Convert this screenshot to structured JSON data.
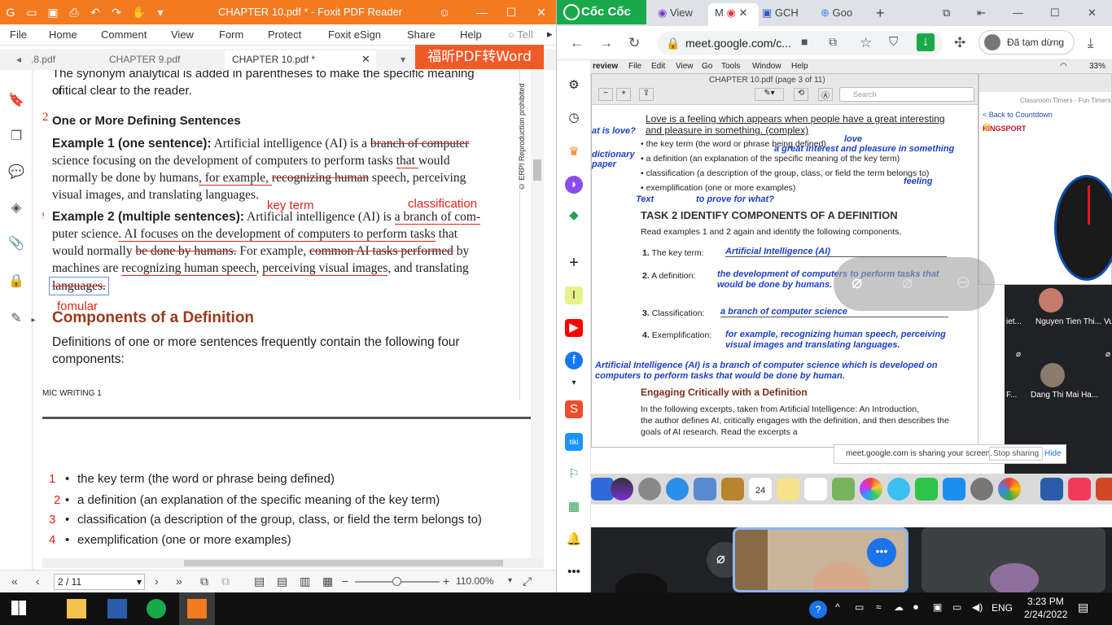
{
  "foxit": {
    "title": "CHAPTER 10.pdf * - Foxit PDF Reader",
    "menu": [
      "File",
      "Home",
      "Comment",
      "View",
      "Form",
      "Protect",
      "Foxit eSign",
      "Share",
      "Help",
      "Tell"
    ],
    "tabs": [
      ".8.pdf",
      "CHAPTER 9.pdf",
      "CHAPTER 10.pdf *"
    ],
    "promo": "福昕PDF转Word",
    "page_indicator": "2 / 11",
    "zoom": "110.00%",
    "watermark": "© ERPI Reproduction prohibited",
    "doc": {
      "line_top": "The synonym analytical is added in parentheses to make the specific meaning of",
      "line_top2": "critical clear to the reader.",
      "heading1": "One or More Defining Sentences",
      "ex1_label": "Example 1 (one sentence):",
      "ex1_text_a": " Artificial intelligence (AI) is a ",
      "ex1_strike": "branch of computer",
      "ex1_line2_a": "science focusing on the development of computers to perform tasks ",
      "ex1_line2_b": "that ",
      "ex1_line2_c": "would",
      "ex1_line3_a": "normally be done by humans",
      "ex1_line3_b": ", for example, ",
      "ex1_line3_c": "recognizing human",
      "ex1_line3_d": " speech, perceiving",
      "ex1_line4": "visual images, and translating languages.",
      "ex2_label": "Example 2 (multiple sentences):",
      "ex2_text_a": " Artificial intelligence (AI) is ",
      "ex2_text_b": "a branch of com-",
      "ex2_line2_a": "puter science",
      "ex2_line2_b": ". AI focuses on the development of computers to ",
      "ex2_line2_c": "perform tasks",
      "ex2_line2_d": " that",
      "ex2_line3_a": "would normally ",
      "ex2_line3_b": "be done by humans.",
      "ex2_line3_c": " For example, ",
      "ex2_line3_d": "common AI tasks performed",
      "ex2_line3_e": " by",
      "ex2_line4_a": "machines are ",
      "ex2_line4_b": "recognizing human speech",
      "ex2_line4_c": ", ",
      "ex2_line4_d": "perceiving visual images",
      "ex2_line4_e": ", and translating",
      "ex2_line5": "languages.",
      "heading2": "Components of a Definition",
      "para2a": "Definitions of one or more sentences frequently contain the following four",
      "para2b": "components:",
      "footer": "MIC WRITING 1",
      "list": [
        "the key term (the word or phrase being defined)",
        "a definition (an explanation of the specific meaning of the key term)",
        "classification (a description of the group, class, or field the term belongs to)",
        "exemplification (one or more examples)"
      ],
      "list_nums": [
        "1",
        "2",
        "3",
        "4"
      ],
      "hw_2": "2",
      "hw_key_term": "key term",
      "hw_classification": "classification",
      "hw_fomular": "fomular",
      "hw_e": "e"
    }
  },
  "browser": {
    "brand": "Cốc Cốc",
    "tabs": [
      "View",
      "M",
      "GCH",
      "Goo"
    ],
    "url": "meet.google.com/c...",
    "paused_label": "Đã tạm dừng",
    "shared": {
      "mac_menu": [
        "review",
        "File",
        "Edit",
        "View",
        "Go",
        "Tools",
        "Window",
        "Help"
      ],
      "doc_title": "CHAPTER 10.pdf (page 3 of 11)",
      "search_placeholder": "Search",
      "side_left": [
        "at is love?",
        "dictionary",
        "paper"
      ],
      "love_line1": "Love is a feeling which appears when people have a great interesting",
      "love_line2": "and pleasure in something. (complex)",
      "bullets": [
        "the key term (the word or phrase being defined)",
        "a definition (an explanation of the specific meaning of the key term)",
        "classification (a description of the group, class, or field the term belongs to)",
        "exemplification (one or more examples)"
      ],
      "hw_love": "love",
      "hw_great": "a great interest and pleasure in something",
      "hw_feeling": "feeling",
      "hw_text": "Text",
      "hw_prove": "to prove for what?",
      "task_title": "TASK 2 IDENTIFY COMPONENTS OF A DEFINITION",
      "task_sub": "Read examples 1 and 2 again and identify the following components.",
      "items": [
        {
          "num": "1.",
          "label": "The key term:",
          "answer": "Artificial Intelligence (AI)"
        },
        {
          "num": "2.",
          "label": "A definition:",
          "answer": "the development of computers to perform tasks that would be done by humans."
        },
        {
          "num": "3.",
          "label": "Classification:",
          "answer": "a branch of computer science"
        },
        {
          "num": "4.",
          "label": "Exemplification:",
          "answer": "for example, recognizing human speech, perceiving visual images and translating languages."
        }
      ],
      "summary": "Artificial Intelligence (AI) is a branch of computer science which is developed on computers to perform tasks that would be done by human.",
      "engaging_title": "Engaging Critically with a Definition",
      "engaging_p1": "In the following excerpts, taken from Artificial Intelligence: An Introduction,",
      "engaging_p2": "the author defines AI, critically engages with the definition, and then describes the",
      "engaging_p3": "goals of AI research. Read the excerpts a",
      "share_notice": "meet.google.com is sharing your screen.",
      "stop_sharing": "Stop sharing",
      "hide": "Hide",
      "back_link": "< Back to Countdown",
      "clock_tab": "Classroom Timers - Fun Timers",
      "kingsport": "KINGSPORT",
      "participants": [
        {
          "name": "Nguyen Tien Thi...",
          "prefix": "iet..."
        },
        {
          "name": "Dang Thi Mai Ha...",
          "prefix": "F..."
        }
      ],
      "vu": "Vu",
      "dock_date": "24"
    }
  },
  "taskbar": {
    "time": "3:23 PM",
    "date": "2/24/2022",
    "lang": "ENG"
  }
}
